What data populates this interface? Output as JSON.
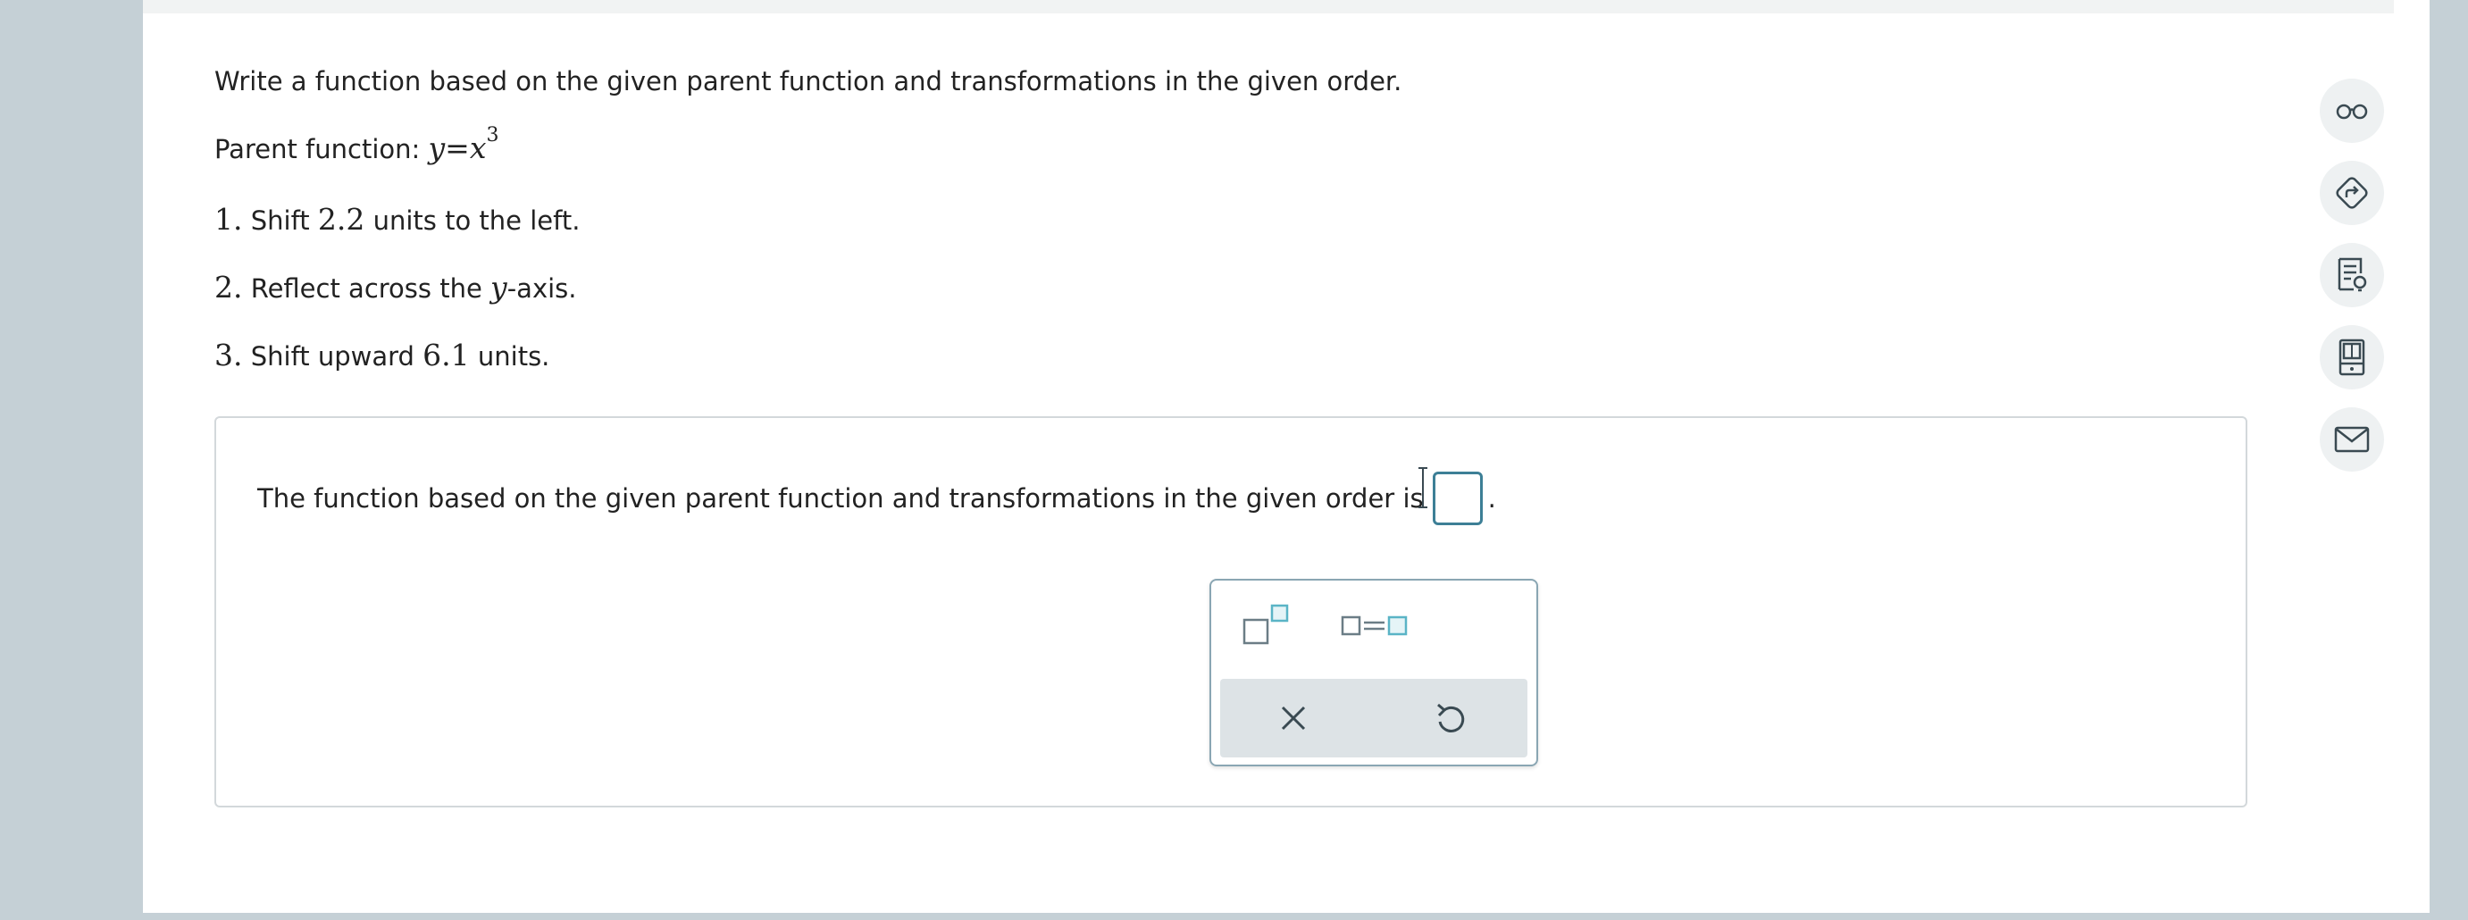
{
  "question": {
    "prompt": "Write a function based on the given parent function and transformations in the given order.",
    "parent_label": "Parent function:",
    "parent_y": "y",
    "parent_eq": "=",
    "parent_x": "x",
    "parent_exp": "3",
    "steps": [
      {
        "num": "1.",
        "pre": "Shift",
        "value": "2.2",
        "post": "units to the left."
      },
      {
        "num": "2.",
        "pre": "Reflect across the",
        "var": "y",
        "post": "-axis."
      },
      {
        "num": "3.",
        "pre": "Shift upward",
        "value": "6.1",
        "post": "units."
      }
    ]
  },
  "answer": {
    "text": "The function based on the given parent function and transformations in the given order is",
    "period": ".",
    "input_value": ""
  },
  "palette": {
    "buttons": [
      "exponent",
      "equation"
    ],
    "footer": [
      "clear",
      "undo"
    ]
  },
  "sidebar": {
    "tools": [
      "view-example",
      "get-help",
      "textbook",
      "calculator",
      "message"
    ]
  },
  "colors": {
    "accent": "#3d7f96",
    "accent_light": "#5ab4c6",
    "page_bg": "#c5d0d6",
    "sidebar_btn_bg": "#eef1f2"
  }
}
